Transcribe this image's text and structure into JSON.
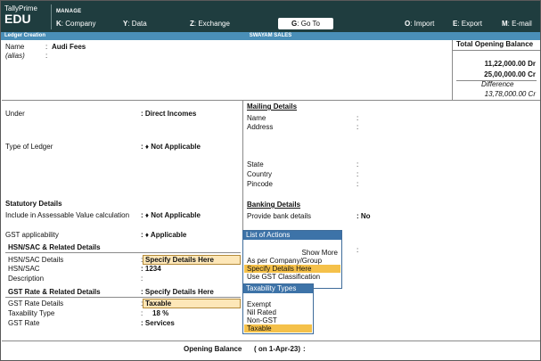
{
  "app": {
    "name": "TallyPrime",
    "edition": "EDU",
    "section": "MANAGE"
  },
  "menu": [
    {
      "key": "K",
      "label": ": Company"
    },
    {
      "key": "Y",
      "label": ": Data"
    },
    {
      "key": "Z",
      "label": ": Exchange"
    },
    {
      "key": "G",
      "label": ": Go To"
    },
    {
      "key": "O",
      "label": ": Import"
    },
    {
      "key": "E",
      "label": ": Export"
    },
    {
      "key": "M",
      "label": ": E-mail"
    }
  ],
  "title_strip": {
    "screen": "Ledger Creation",
    "company": "SWAYAM SALES"
  },
  "ledger": {
    "name_label": "Name",
    "name_value": "Audi Fees",
    "alias_label": "(alias)",
    "colon": ":"
  },
  "opening_summary": {
    "title": "Total Opening Balance",
    "dr": "11,22,000.00 Dr",
    "cr": "25,00,000.00 Cr",
    "diff_label": "Difference",
    "diff": "13,78,000.00 Cr"
  },
  "left": {
    "under_label": "Under",
    "under_value": "Direct Incomes",
    "type_label": "Type of Ledger",
    "type_value": "♦ Not Applicable",
    "statutory_header": "Statutory Details",
    "assessable_label": "Include in Assessable Value calculation",
    "assessable_value": "♦ Not Applicable",
    "gst_app_label": "GST applicability",
    "gst_app_value": "♦ Applicable",
    "hsn_header": "HSN/SAC & Related Details",
    "hsn_details_label": "HSN/SAC Details",
    "hsn_details_value": "Specify Details Here",
    "hsn_label": "HSN/SAC",
    "hsn_value": "1234",
    "desc_label": "Description",
    "gst_rate_header": "GST Rate & Related Details",
    "gst_rate_header_value": "Specify Details Here",
    "gst_rate_details_label": "GST Rate Details",
    "gst_rate_details_value": "Taxable",
    "taxability_label": "Taxability Type",
    "taxability_value": "18 %",
    "gst_rate_label": "GST Rate",
    "gst_rate_value": "Services"
  },
  "right": {
    "mailing_header": "Mailing Details",
    "name_label": "Name",
    "address_label": "Address",
    "state_label": "State",
    "country_label": "Country",
    "pincode_label": "Pincode",
    "banking_header": "Banking Details",
    "bank_label": "Provide bank details",
    "bank_value": "No"
  },
  "list_of_actions": {
    "title": "List of Actions",
    "show_more": "Show More",
    "items": [
      "As per Company/Group",
      "Specify Details Here",
      "Use GST Classification"
    ],
    "selected_index": 1
  },
  "taxability_types": {
    "title": "Taxability Types",
    "items": [
      "Exempt",
      "Nil Rated",
      "Non-GST",
      "Taxable"
    ],
    "selected_index": 3
  },
  "footer": {
    "label": "Opening Balance",
    "date": "( on 1-Apr-23)",
    "colon": ":"
  }
}
